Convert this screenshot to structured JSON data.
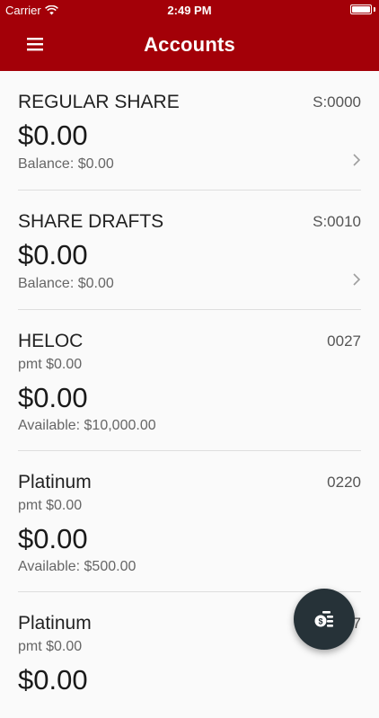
{
  "status_bar": {
    "carrier": "Carrier",
    "time": "2:49 PM"
  },
  "header": {
    "title": "Accounts"
  },
  "accounts": [
    {
      "name": "REGULAR SHARE",
      "number": "S:0000",
      "amount": "$0.00",
      "detail": "Balance: $0.00"
    },
    {
      "name": "SHARE DRAFTS",
      "number": "S:0010",
      "amount": "$0.00",
      "detail": "Balance: $0.00"
    },
    {
      "name": "HELOC",
      "number": "0027",
      "payment": "pmt $0.00",
      "amount": "$0.00",
      "detail": "Available: $10,000.00"
    },
    {
      "name": "Platinum",
      "number": "0220",
      "payment": "pmt $0.00",
      "amount": "$0.00",
      "detail": "Available: $500.00"
    },
    {
      "name": "Platinum",
      "number": "7",
      "payment": "pmt $0.00",
      "amount": "$0.00"
    }
  ],
  "colors": {
    "header": "#a30008",
    "fab": "#263238"
  },
  "icons": {
    "menu": "hamburger-menu-icon",
    "fab": "money-transfer-icon",
    "row": "chevron-right-icon"
  }
}
